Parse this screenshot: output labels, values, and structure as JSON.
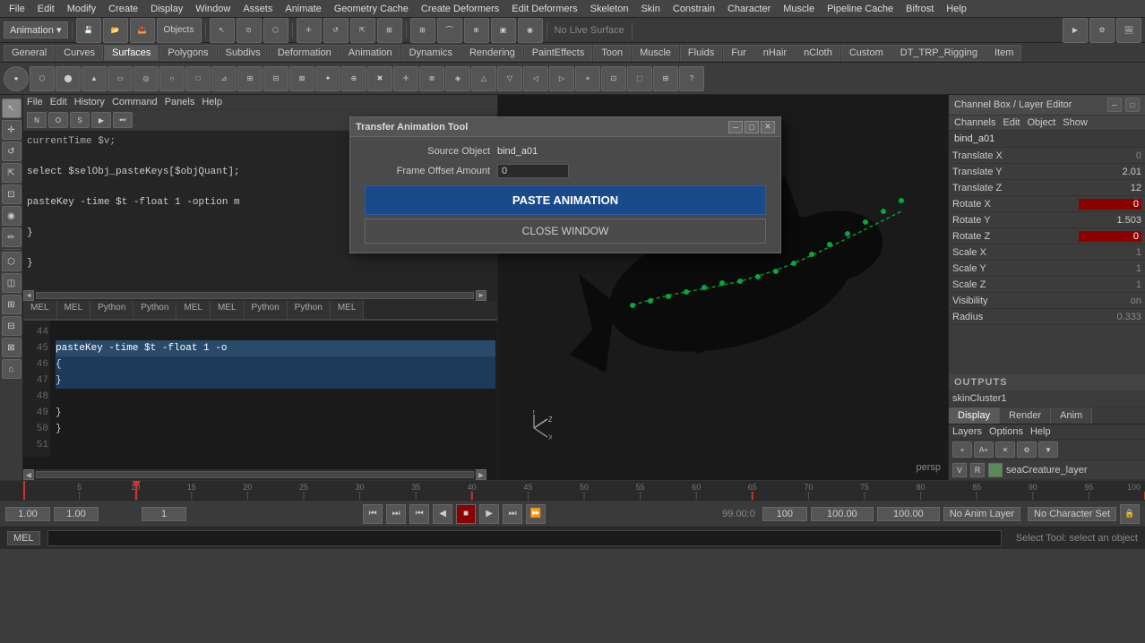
{
  "menubar": {
    "items": [
      "File",
      "Edit",
      "Modify",
      "Create",
      "Display",
      "Window",
      "Assets",
      "Animate",
      "Geometry Cache",
      "Create Deformers",
      "Edit Deformers",
      "Skeleton",
      "Skin",
      "Constrain",
      "Character",
      "Muscle",
      "Pipeline Cache",
      "Bifrost",
      "Help"
    ]
  },
  "toolbar1": {
    "dropdown": "Animation",
    "objects_label": "Objects"
  },
  "shelf": {
    "tabs": [
      "General",
      "Curves",
      "Surfaces",
      "Polygons",
      "Subdivs",
      "Deformation",
      "Animation",
      "Dynamics",
      "Rendering",
      "PaintEffects",
      "Toon",
      "Muscle",
      "Fluids",
      "Fur",
      "nHair",
      "nCloth",
      "Custom",
      "DT_TRP_Rigging",
      "Item"
    ],
    "active_tab": "Surfaces"
  },
  "script_editor": {
    "top_tabs": [
      "MEL",
      "MEL",
      "Python",
      "Python",
      "MEL",
      "MEL",
      "Python",
      "Python",
      "MEL"
    ],
    "top_code": [
      "currentTime $v;",
      "",
      "select $selObj_pasteKeys[$objQuant];",
      "",
      "pasteKey -time $t -float 1 -option m",
      "",
      "    }",
      "",
      "}"
    ],
    "bottom_tabs": [
      "MEL",
      "MEL",
      "Python",
      "Python",
      "MEL",
      "MEL",
      "Python",
      "Python",
      "MEL"
    ],
    "line_numbers": [
      "44",
      "45",
      "46",
      "47",
      "48",
      "49",
      "50",
      "51"
    ],
    "bottom_lines": [
      "",
      "pasteKey -time $t -float 1 -o",
      "    {",
      "    }",
      "",
      "    }",
      "}",
      ""
    ],
    "highlighted_line": 45
  },
  "viewport": {
    "label": "persp"
  },
  "dialog": {
    "title": "Transfer Animation Tool",
    "source_label": "Source Object",
    "source_value": "bind_a01",
    "frame_offset_label": "Frame Offset Amount",
    "frame_offset_value": "0",
    "paste_button": "PASTE ANIMATION",
    "close_button": "CLOSE WINDOW",
    "min_btn": "─",
    "max_btn": "□",
    "close_x": "✕"
  },
  "channel_box": {
    "title": "Channel Box / Layer Editor",
    "menus": [
      "Channels",
      "Edit",
      "Object",
      "Show"
    ],
    "object_name": "bind_a01",
    "channels": [
      {
        "name": "Translate X",
        "value": "0",
        "style": "zero"
      },
      {
        "name": "Translate Y",
        "value": "2.01",
        "style": "nonzero"
      },
      {
        "name": "Translate Z",
        "value": "12",
        "style": "nonzero"
      },
      {
        "name": "Rotate X",
        "value": "0",
        "style": "red-bg"
      },
      {
        "name": "Rotate Y",
        "value": "1.503",
        "style": "nonzero"
      },
      {
        "name": "Rotate Z",
        "value": "0",
        "style": "red-bg"
      },
      {
        "name": "Scale X",
        "value": "1",
        "style": "default"
      },
      {
        "name": "Scale Y",
        "value": "1",
        "style": "default"
      },
      {
        "name": "Scale Z",
        "value": "1",
        "style": "default"
      },
      {
        "name": "Visibility",
        "value": "on",
        "style": "default"
      },
      {
        "name": "Radius",
        "value": "0.333",
        "style": "default"
      }
    ],
    "outputs_label": "OUTPUTS",
    "outputs": [
      "skinCluster1"
    ],
    "layer_tabs": [
      "Display",
      "Render",
      "Anim"
    ],
    "active_layer_tab": "Display",
    "layer_menus": [
      "Layers",
      "Options",
      "Help"
    ],
    "layers": [
      {
        "v": "V",
        "r": "R",
        "color": "#5a8a5a",
        "name": "seaCreature_layer"
      }
    ]
  },
  "playback": {
    "current_frame": "1.00",
    "inner_start": "1.00",
    "inner_end": "100",
    "range_start": "100.00",
    "range_end": "100.00",
    "no_anim_layer": "No Anim Layer",
    "no_char_set": "No Character Set",
    "buttons": [
      "⏮",
      "⏭",
      "⏮",
      "◀",
      "■",
      "▶",
      "⏭",
      "⏩"
    ]
  },
  "status_bar": {
    "mel_label": "MEL",
    "status_text": "Select Tool: select an object"
  },
  "timeline": {
    "ticks": [
      5,
      10,
      15,
      20,
      25,
      30,
      35,
      40,
      45,
      50,
      55,
      60,
      65,
      70,
      75,
      80,
      85,
      90,
      95,
      100
    ]
  }
}
